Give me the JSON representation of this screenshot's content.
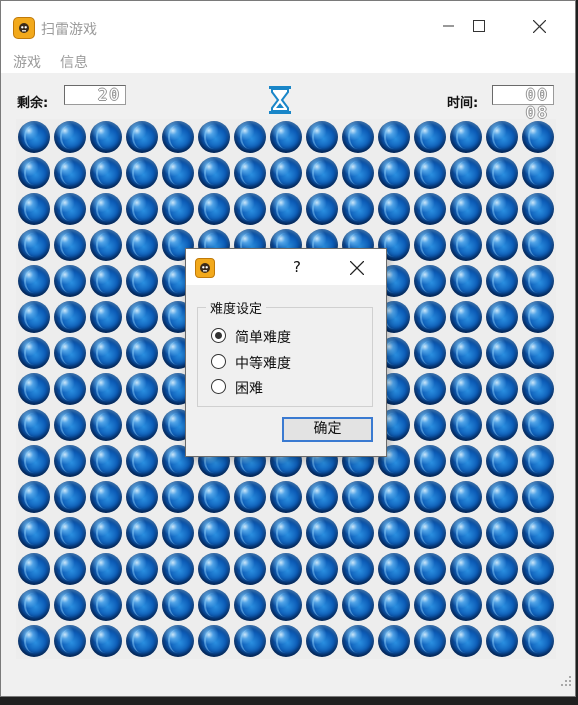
{
  "window": {
    "title": "扫雷游戏",
    "icon": "skull-mine-icon"
  },
  "menu": {
    "items": [
      "游戏",
      "信息"
    ]
  },
  "toolbar": {
    "remaining_label": "剩余:",
    "remaining_value": "20",
    "timer_label": "时间:",
    "timer_value": "00 08",
    "timer_icon": "hourglass-icon"
  },
  "board": {
    "rows": 15,
    "cols": 15,
    "cell_state": "covered",
    "cell_icon": "blue-orb-icon"
  },
  "dialog": {
    "help_label": "?",
    "group_title": "难度设定",
    "options": [
      {
        "label": "简单难度",
        "checked": true
      },
      {
        "label": "中等难度",
        "checked": false
      },
      {
        "label": "困难",
        "checked": false
      }
    ],
    "ok_label": "确定"
  },
  "colors": {
    "accent_blue": "#1a86c8",
    "button_focus_border": "#3a7ad1",
    "orb_blue": "#0d5db8",
    "app_icon_orange": "#f2a91c"
  }
}
